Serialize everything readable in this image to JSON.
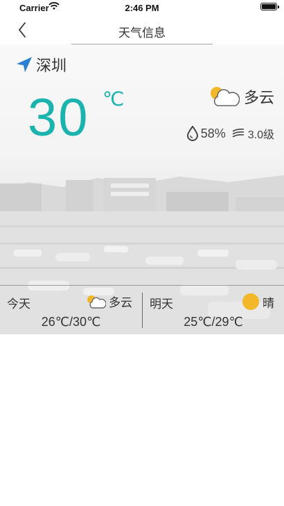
{
  "status_bar": {
    "carrier": "Carrier",
    "time": "2:46 PM"
  },
  "nav": {
    "title": "天气信息",
    "back_icon": "chevron-left-icon"
  },
  "weather": {
    "city": "深圳",
    "temperature": "30",
    "unit": "℃",
    "condition": "多云",
    "humidity": "58%",
    "wind": "3.0级"
  },
  "forecast": {
    "today": {
      "label": "今天",
      "condition": "多云",
      "range": "26℃/30℃",
      "icon": "partly-cloudy-icon"
    },
    "tomorrow": {
      "label": "明天",
      "condition": "晴",
      "range": "25℃/29℃",
      "icon": "sun-icon"
    }
  },
  "colors": {
    "accent": "#1bb3ae",
    "location_arrow": "#2a7fd0",
    "sun": "#f2b82a"
  }
}
